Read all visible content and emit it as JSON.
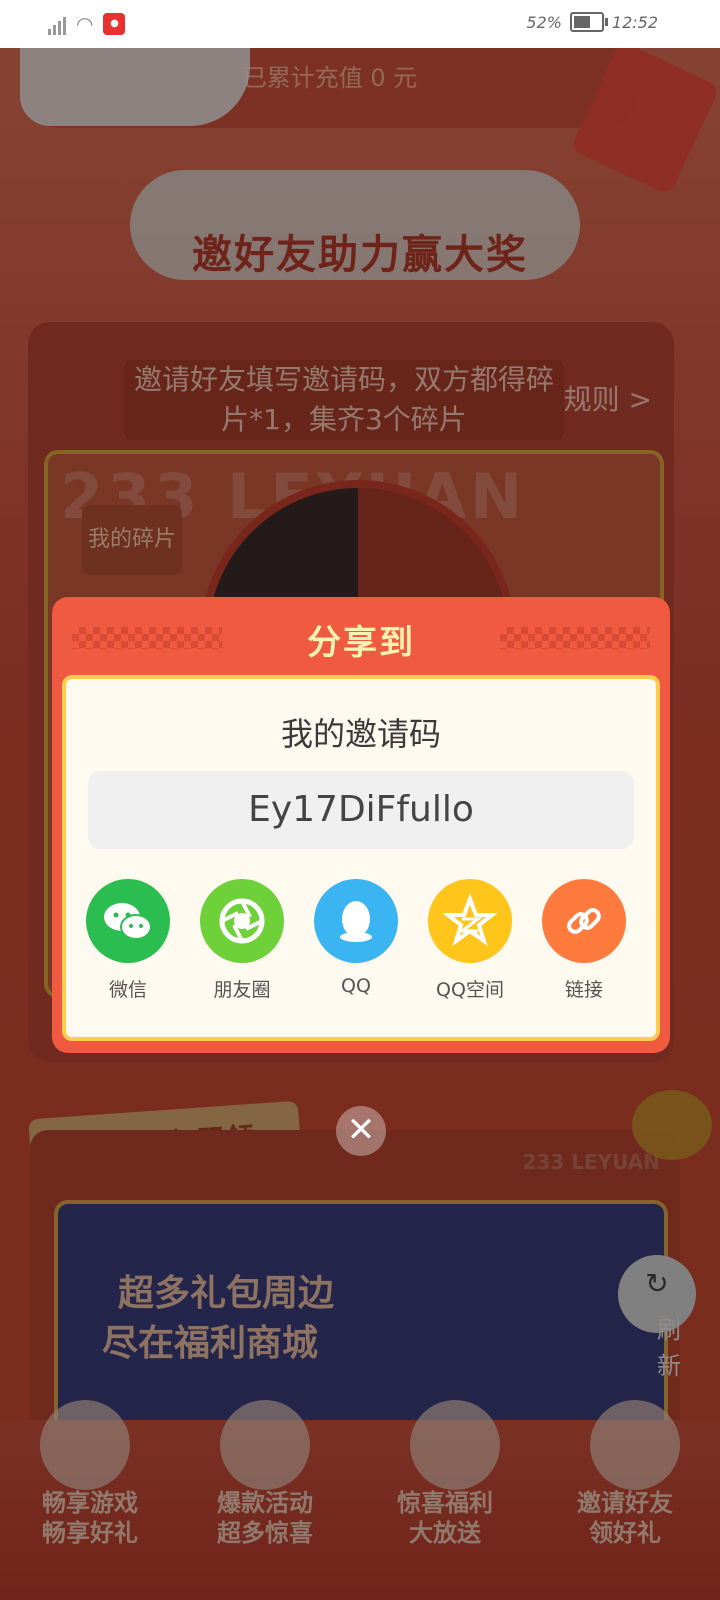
{
  "status_bar": {
    "battery": "52%",
    "time": "12:52"
  },
  "background": {
    "recharge_text": "已累计充值 0 元",
    "invite_title": "邀好友助力赢大奖",
    "invite_hint": "邀请好友填写邀请码，双方都得碎片*1，集齐3个碎片",
    "rules_link": "规则 >",
    "big_text": "233 LEYUAN",
    "my_fragment": "我的碎片",
    "gift_section_title": "游戏礼包加码领",
    "leyuan_brand": "233 LEYUAN",
    "promo_line1": "超多礼包周边",
    "promo_line2": "尽在福利商城",
    "refresh_label": "刷新",
    "bottom_nav": [
      {
        "line1": "畅享游戏",
        "line2": "畅享好礼"
      },
      {
        "line1": "爆款活动",
        "line2": "超多惊喜"
      },
      {
        "line1": "惊喜福利",
        "line2": "大放送"
      },
      {
        "line1": "邀请好友",
        "line2": "领好礼"
      }
    ]
  },
  "dialog": {
    "title": "分享到",
    "code_label": "我的邀请码",
    "code_value": "Ey17DiFfullo",
    "share_targets": [
      {
        "label": "微信",
        "icon": "wechat-icon",
        "color": "#2bbd4f"
      },
      {
        "label": "朋友圈",
        "icon": "moments-icon",
        "color": "#6fd13a"
      },
      {
        "label": "QQ",
        "icon": "qq-icon",
        "color": "#3bb4f2"
      },
      {
        "label": "QQ空间",
        "icon": "qzone-icon",
        "color": "#ffc51a"
      },
      {
        "label": "链接",
        "icon": "link-icon",
        "color": "#ff7a3d"
      }
    ]
  }
}
